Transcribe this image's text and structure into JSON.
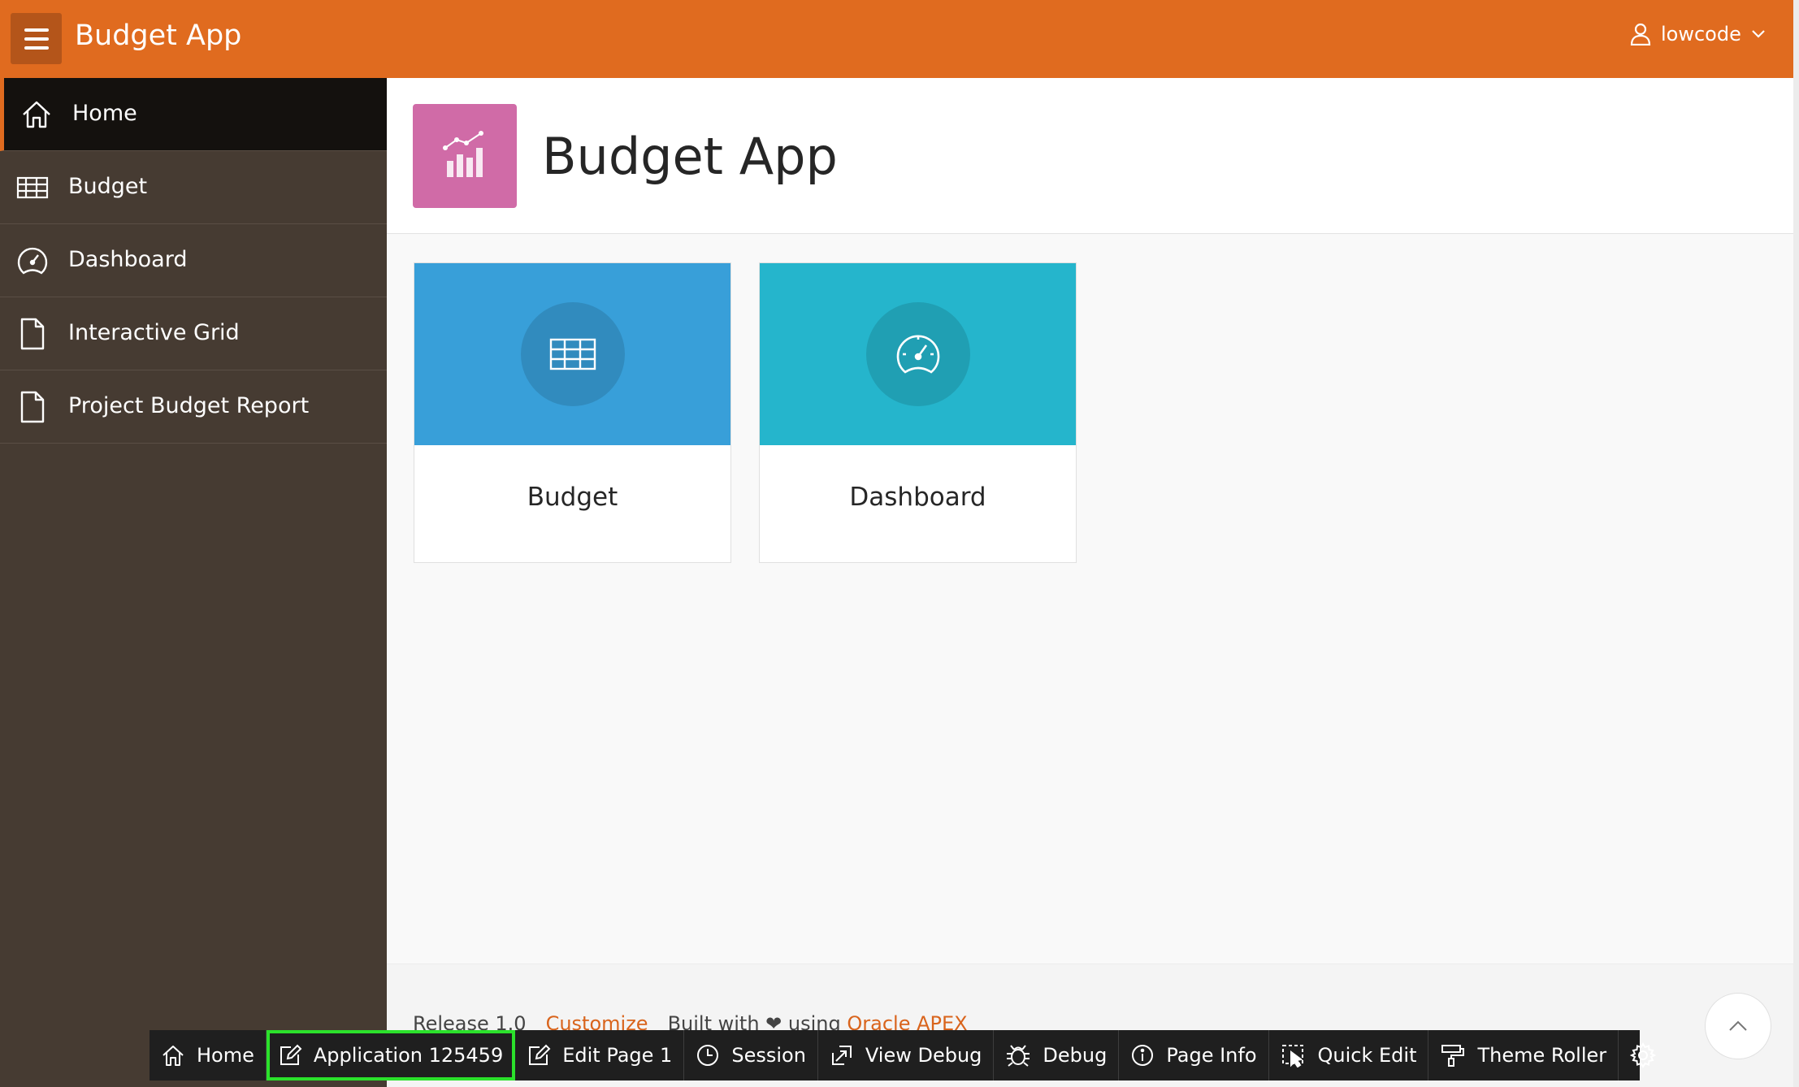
{
  "header": {
    "app_title": "Budget App",
    "user_name": "lowcode"
  },
  "sidebar": {
    "items": [
      {
        "label": "Home",
        "icon": "home-icon",
        "active": true
      },
      {
        "label": "Budget",
        "icon": "table-icon"
      },
      {
        "label": "Dashboard",
        "icon": "gauge-icon"
      },
      {
        "label": "Interactive Grid",
        "icon": "file-icon"
      },
      {
        "label": "Project Budget Report",
        "icon": "file-icon"
      }
    ]
  },
  "hero": {
    "title": "Budget App",
    "icon": "chart-icon",
    "icon_color": "#d06ba7"
  },
  "cards": [
    {
      "label": "Budget",
      "icon": "table-icon",
      "color": "#389fd9"
    },
    {
      "label": "Dashboard",
      "icon": "gauge-icon",
      "color": "#25b5cc"
    }
  ],
  "footer": {
    "release": "Release 1.0",
    "customize": "Customize",
    "built_with": "Built with",
    "using": "using",
    "apex_link": "Oracle APEX"
  },
  "devbar": {
    "items": [
      {
        "label": "Home",
        "icon": "home-icon"
      },
      {
        "label": "Application 125459",
        "icon": "edit-app-icon",
        "highlighted": true
      },
      {
        "label": "Edit Page 1",
        "icon": "edit-page-icon"
      },
      {
        "label": "Session",
        "icon": "clock-icon"
      },
      {
        "label": "View Debug",
        "icon": "view-debug-icon"
      },
      {
        "label": "Debug",
        "icon": "bug-icon"
      },
      {
        "label": "Page Info",
        "icon": "info-icon"
      },
      {
        "label": "Quick Edit",
        "icon": "quick-edit-icon"
      },
      {
        "label": "Theme Roller",
        "icon": "paint-roller-icon"
      }
    ]
  },
  "colors": {
    "header": "#e06b1f",
    "sidebar": "#463b32",
    "sidebar_active": "#14110e",
    "highlight_outline": "#2be12b"
  }
}
